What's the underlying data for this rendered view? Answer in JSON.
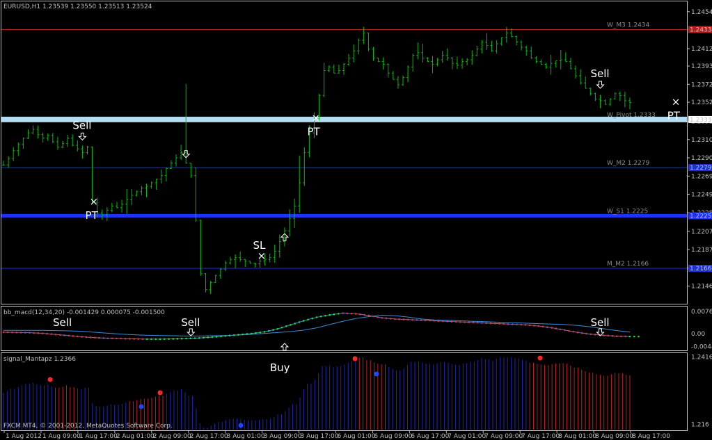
{
  "chart_data": {
    "type": "candlestick",
    "title": "EURUSD,H1  1.23539 1.23550 1.23513 1.23524",
    "symbol": "EURUSD",
    "timeframe": "H1",
    "ohlc": {
      "open": 1.23539,
      "high": 1.2355,
      "low": 1.23513,
      "close": 1.23524
    },
    "colors": {
      "background": "#000000",
      "bars": "#00c000",
      "axis": "#c0c0c0"
    },
    "price_axis": {
      "ticks": [
        1.2454,
        1.24125,
        1.2393,
        1.23725,
        1.23524,
        1.2331,
        1.23105,
        1.229,
        1.22695,
        1.2249,
        1.22285,
        1.22075,
        1.2187,
        1.21665,
        1.2146
      ],
      "ylim": [
        1.2127,
        1.2464
      ]
    },
    "time_axis": [
      "1 Aug 2012",
      "1 Aug 09:00",
      "1 Aug 17:00",
      "2 Aug 01:00",
      "2 Aug 09:00",
      "2 Aug 17:00",
      "3 Aug 01:00",
      "3 Aug 09:00",
      "3 Aug 17:00",
      "6 Aug 01:00",
      "6 Aug 09:00",
      "6 Aug 17:00",
      "7 Aug 01:00",
      "7 Aug 09:00",
      "7 Aug 17:00",
      "8 Aug 01:00",
      "8 Aug 09:00",
      "8 Aug 17:00"
    ],
    "price_path": [
      1.2282,
      1.2289,
      1.2298,
      1.2305,
      1.2312,
      1.2318,
      1.2322,
      1.2316,
      1.2312,
      1.2315,
      1.2308,
      1.2302,
      1.2306,
      1.2312,
      1.2304,
      1.23,
      1.2296,
      1.2302,
      1.224,
      1.2228,
      1.2226,
      1.2231,
      1.2236,
      1.2234,
      1.2238,
      1.2243,
      1.2248,
      1.2252,
      1.2256,
      1.2258,
      1.2262,
      1.2266,
      1.227,
      1.2278,
      1.2284,
      1.229,
      1.2296,
      1.2284,
      1.227,
      1.222,
      1.216,
      1.2142,
      1.215,
      1.2158,
      1.2165,
      1.2172,
      1.2176,
      1.2178,
      1.2176,
      1.2174,
      1.2172,
      1.2171,
      1.2174,
      1.2176,
      1.2178,
      1.2185,
      1.2196,
      1.2208,
      1.2222,
      1.2236,
      1.2262,
      1.2296,
      1.2318,
      1.2334,
      1.236,
      1.2388,
      1.2392,
      1.2385,
      1.2388,
      1.2395,
      1.2402,
      1.241,
      1.2422,
      1.243,
      1.2412,
      1.2402,
      1.2398,
      1.2395,
      1.2385,
      1.2378,
      1.2372,
      1.238,
      1.2392,
      1.2405,
      1.2408,
      1.2402,
      1.2398,
      1.2395,
      1.24,
      1.2405,
      1.2402,
      1.2396,
      1.2394,
      1.2398,
      1.24,
      1.2405,
      1.2412,
      1.242,
      1.2416,
      1.241,
      1.2418,
      1.2425,
      1.243,
      1.2426,
      1.242,
      1.2414,
      1.241,
      1.2402,
      1.2398,
      1.2395,
      1.2392,
      1.2396,
      1.2399,
      1.24,
      1.2398,
      1.239,
      1.2382,
      1.2374,
      1.2368,
      1.2362,
      1.2356,
      1.2354,
      1.235,
      1.2356,
      1.2362,
      1.236,
      1.2354,
      1.2352
    ],
    "levels": [
      {
        "name": "W_M3",
        "value": 1.2434,
        "label": "W_M3 1.2434",
        "axis_tag": "1.24339",
        "color": "#b41e1e",
        "width": 1
      },
      {
        "name": "W_Pivot",
        "value": 1.2333,
        "label": "W_Pivot 1.2333",
        "axis_tag": "1.23335",
        "color": "#b4dcf0",
        "width": 8
      },
      {
        "name": "W_M2",
        "value": 1.2279,
        "label": "W_M2 1.2279",
        "axis_tag": "1.22790",
        "color": "#1e32dc",
        "width": 1
      },
      {
        "name": "W_S1",
        "value": 1.2225,
        "label": "W_S1 1.2225",
        "axis_tag": "1.22250",
        "color": "#1e32ff",
        "width": 5
      },
      {
        "name": "M_M2",
        "value": 1.2166,
        "label": "M_M2 1.2166",
        "axis_tag": "1.21660",
        "color": "#1e32dc",
        "width": 1
      }
    ],
    "annotations": [
      {
        "text": "Sell",
        "x_index": 16,
        "arrow": "down"
      },
      {
        "text": "PT",
        "x_index": 18,
        "arrow": "none"
      },
      {
        "text": "",
        "x_index": 37,
        "arrow": "down"
      },
      {
        "text": "SL",
        "x_index": 52,
        "arrow": "none"
      },
      {
        "text": "",
        "x_index": 57,
        "arrow": "up"
      },
      {
        "text": "PT",
        "x_index": 63,
        "arrow": "none"
      },
      {
        "text": "Sell",
        "x_index": 121,
        "arrow": "down"
      },
      {
        "text": "PT",
        "x_index": 136,
        "arrow": "none"
      }
    ],
    "indicators": [
      {
        "name": "bb_macd",
        "header": "bb_macd(12,34,20) -0.001429 0.000075 -0.001500",
        "ticks": [
          "0.00760",
          "0.00",
          "-0.00444"
        ],
        "ylim": [
          -0.0055,
          0.0088
        ],
        "values": [
          0.0005,
          0.0004,
          0.0003,
          0.0001,
          -0.0003,
          -0.0007,
          -0.0011,
          -0.0014,
          -0.0016,
          -0.0017,
          -0.0018,
          -0.0019,
          -0.0019,
          -0.0018,
          -0.0017,
          -0.0015,
          -0.0012,
          -0.0008,
          -0.0004,
          0.0,
          0.0006,
          0.0016,
          0.003,
          0.0044,
          0.0056,
          0.0064,
          0.007,
          0.0068,
          0.0062,
          0.0054,
          0.005,
          0.0048,
          0.0046,
          0.0044,
          0.0042,
          0.004,
          0.0038,
          0.0036,
          0.0034,
          0.0032,
          0.003,
          0.0026,
          0.002,
          0.0012,
          0.0004,
          -0.0002,
          -0.0006,
          -0.0009,
          -0.001
        ],
        "annotations": [
          {
            "text": "Sell",
            "x_index": 12,
            "arrow": "none"
          },
          {
            "text": "Sell",
            "x_index": 38,
            "arrow": "down"
          },
          {
            "text": "",
            "x_index": 57,
            "arrow": "up"
          },
          {
            "text": "Sell",
            "x_index": 121,
            "arrow": "down"
          }
        ]
      },
      {
        "name": "signal_Mantapz",
        "header": "signal_Mantapz 1.2366",
        "ticks": [
          "1.2416",
          "1.216"
        ],
        "ylim": [
          1.214,
          1.2425
        ],
        "annotations": [
          {
            "text": "Buy",
            "x_index": 56,
            "arrow": "none"
          }
        ]
      }
    ],
    "footer": "FXCM MT4, © 2001-2012, MetaQuotes Software Corp."
  }
}
